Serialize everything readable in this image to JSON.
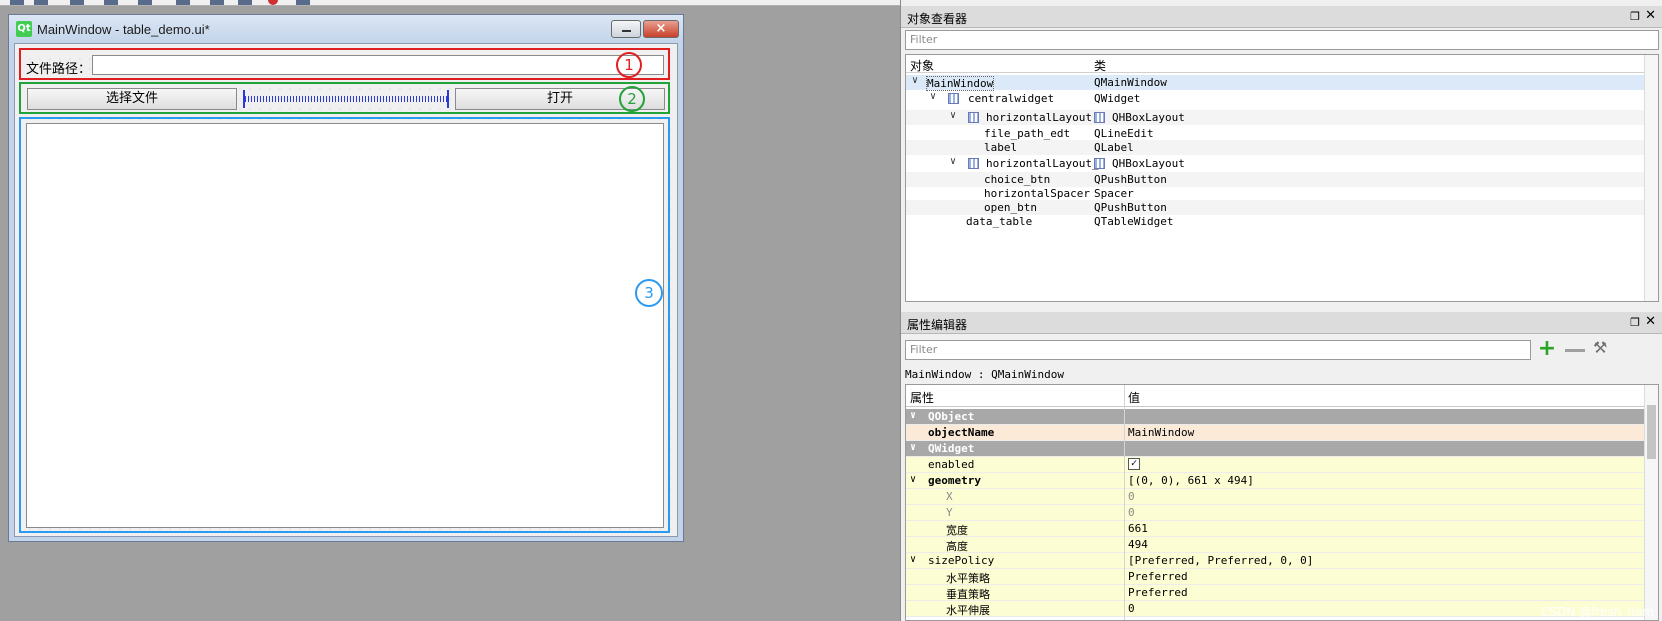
{
  "form_window": {
    "title": "MainWindow - table_demo.ui*",
    "logo_text": "Qt",
    "close_glyph": "×",
    "file_path_label": "文件路径：",
    "file_path_value": "",
    "choice_button": "选择文件",
    "open_button": "打开",
    "markers": [
      "1",
      "2",
      "3"
    ],
    "marker_colors": [
      "#e02020",
      "#22a33a",
      "#2a9af0"
    ]
  },
  "object_inspector": {
    "title": "对象查看器",
    "filter_placeholder": "Filter",
    "col_object": "对象",
    "col_class": "类",
    "rows": [
      {
        "name": "MainWindow",
        "cls": "QMainWindow"
      },
      {
        "name": "centralwidget",
        "cls": "QWidget"
      },
      {
        "name": "horizontalLayout",
        "cls": "QHBoxLayout"
      },
      {
        "name": "file_path_edt",
        "cls": "QLineEdit"
      },
      {
        "name": "label",
        "cls": "QLabel"
      },
      {
        "name": "horizontalLayout_2",
        "cls": "QHBoxLayout"
      },
      {
        "name": "choice_btn",
        "cls": "QPushButton"
      },
      {
        "name": "horizontalSpacer",
        "cls": "Spacer"
      },
      {
        "name": "open_btn",
        "cls": "QPushButton"
      },
      {
        "name": "data_table",
        "cls": "QTableWidget"
      }
    ]
  },
  "property_editor": {
    "title": "属性编辑器",
    "filter_placeholder": "Filter",
    "object_path": "MainWindow : QMainWindow",
    "col_property": "属性",
    "col_value": "值",
    "rows": {
      "qobject": "QObject",
      "objectName_key": "objectName",
      "objectName_val": "MainWindow",
      "qwidget": "QWidget",
      "enabled_key": "enabled",
      "enabled_checked": true,
      "geometry_key": "geometry",
      "geometry_val": "[(0, 0), 661 x 494]",
      "x_key": "X",
      "x_val": "0",
      "y_key": "Y",
      "y_val": "0",
      "width_key": "宽度",
      "width_val": "661",
      "height_key": "高度",
      "height_val": "494",
      "sizePolicy_key": "sizePolicy",
      "sizePolicy_val": "[Preferred, Preferred, 0, 0]",
      "hpolicy_key": "水平策略",
      "hpolicy_val": "Preferred",
      "vpolicy_key": "垂直策略",
      "vpolicy_val": "Preferred",
      "hstretch_key": "水平伸展",
      "hstretch_val": "0"
    }
  },
  "watermark": "CSDN @fresh_nam"
}
